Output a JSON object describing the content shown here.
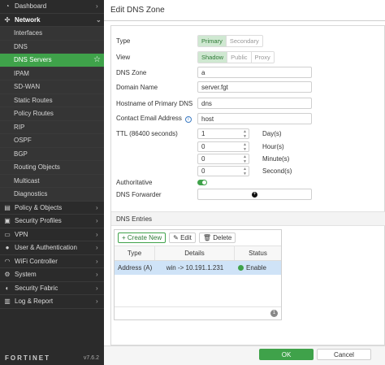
{
  "sidebar": {
    "items": [
      {
        "label": "Dashboard",
        "icon": "dashboard-icon",
        "level": "top",
        "chevron": "›"
      },
      {
        "label": "Network",
        "icon": "network-icon",
        "level": "top-open",
        "chevron": "⌄"
      },
      {
        "label": "Interfaces",
        "level": "sub"
      },
      {
        "label": "DNS",
        "level": "sub"
      },
      {
        "label": "DNS Servers",
        "level": "sub",
        "active": true
      },
      {
        "label": "IPAM",
        "level": "sub"
      },
      {
        "label": "SD-WAN",
        "level": "sub"
      },
      {
        "label": "Static Routes",
        "level": "sub"
      },
      {
        "label": "Policy Routes",
        "level": "sub"
      },
      {
        "label": "RIP",
        "level": "sub"
      },
      {
        "label": "OSPF",
        "level": "sub"
      },
      {
        "label": "BGP",
        "level": "sub"
      },
      {
        "label": "Routing Objects",
        "level": "sub"
      },
      {
        "label": "Multicast",
        "level": "sub"
      },
      {
        "label": "Diagnostics",
        "level": "sub"
      },
      {
        "label": "Policy & Objects",
        "icon": "policy-icon",
        "level": "top",
        "chevron": "›"
      },
      {
        "label": "Security Profiles",
        "icon": "lock-icon",
        "level": "top",
        "chevron": "›"
      },
      {
        "label": "VPN",
        "icon": "vpn-icon",
        "level": "top",
        "chevron": "›"
      },
      {
        "label": "User & Authentication",
        "icon": "user-icon",
        "level": "top",
        "chevron": "›"
      },
      {
        "label": "WiFi Controller",
        "icon": "wifi-icon",
        "level": "top",
        "chevron": "›"
      },
      {
        "label": "System",
        "icon": "gear-icon",
        "level": "top",
        "chevron": "›"
      },
      {
        "label": "Security Fabric",
        "icon": "fabric-icon",
        "level": "top",
        "chevron": "›"
      },
      {
        "label": "Log & Report",
        "icon": "chart-icon",
        "level": "top",
        "chevron": "›"
      }
    ],
    "active_star": "☆",
    "logo": "FORTINET",
    "version": "v7.6.2"
  },
  "header": {
    "title": "Edit DNS Zone"
  },
  "form": {
    "type_label": "Type",
    "type_options": [
      "Primary",
      "Secondary"
    ],
    "view_label": "View",
    "view_options": [
      "Shadow",
      "Public",
      "Proxy"
    ],
    "dns_zone_label": "DNS Zone",
    "dns_zone_value": "a",
    "domain_name_label": "Domain Name",
    "domain_name_value": "server.fgt",
    "hostname_label": "Hostname of Primary DNS",
    "hostname_value": "dns",
    "contact_label": "Contact Email Address",
    "contact_info_icon": "i",
    "contact_value": "host",
    "ttl_label": "TTL (86400 seconds)",
    "ttl_days": "1",
    "ttl_days_unit": "Day(s)",
    "ttl_hours": "0",
    "ttl_hours_unit": "Hour(s)",
    "ttl_minutes": "0",
    "ttl_minutes_unit": "Minute(s)",
    "ttl_seconds": "0",
    "ttl_seconds_unit": "Second(s)",
    "authoritative_label": "Authoritative",
    "authoritative_on": true,
    "forwarder_label": "DNS Forwarder",
    "forwarder_plus": "+"
  },
  "entries": {
    "section_title": "DNS Entries",
    "create_label": "+ Create New",
    "edit_label": "✎ Edit",
    "delete_label": "🗑 Delete",
    "columns": [
      "Type",
      "Details",
      "Status"
    ],
    "rows": [
      {
        "type": "Address (A)",
        "details": "win -> 10.191.1.231",
        "status": "Enable"
      }
    ],
    "count": "1"
  },
  "footer": {
    "ok_label": "OK",
    "cancel_label": "Cancel"
  },
  "colors": {
    "accent": "#3fa24a",
    "sidebar_bg": "#2b2b2b",
    "selected_row": "#cfe3f7"
  }
}
